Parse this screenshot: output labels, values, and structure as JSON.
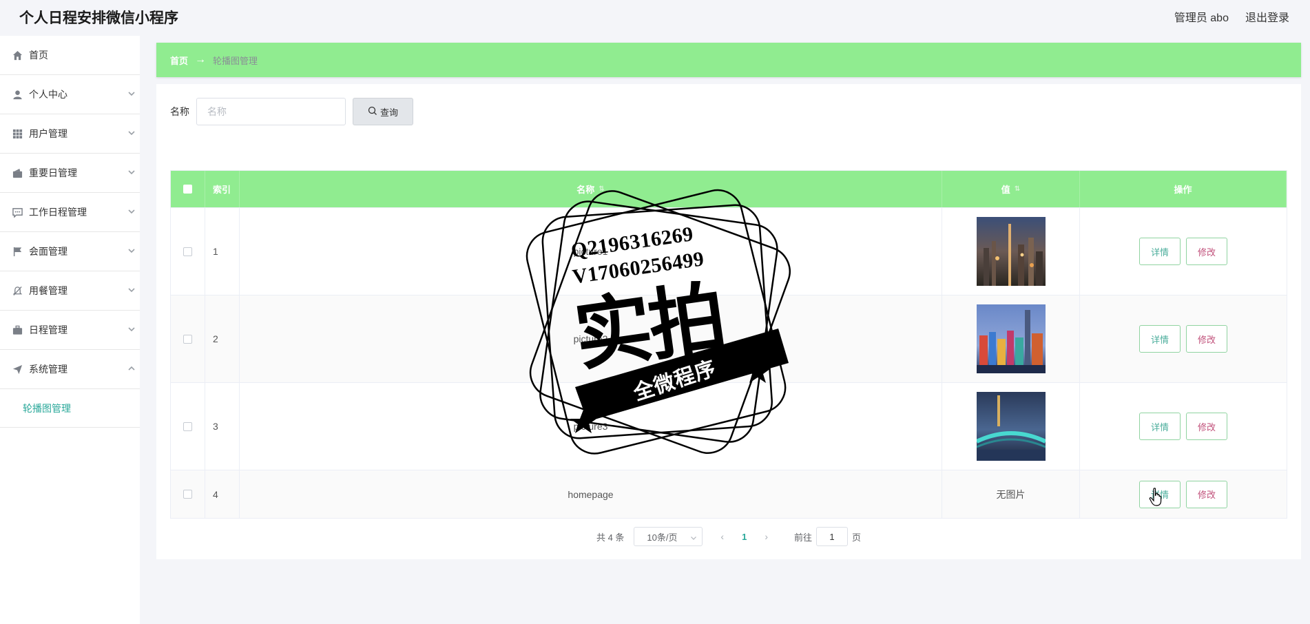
{
  "app": {
    "title": "个人日程安排微信小程序",
    "user_label": "管理员 abo",
    "logout_label": "退出登录"
  },
  "sidebar": {
    "items": [
      {
        "label": "首页",
        "icon": "home-icon",
        "has_chevron": false
      },
      {
        "label": "个人中心",
        "icon": "user-icon",
        "has_chevron": true
      },
      {
        "label": "用户管理",
        "icon": "grid-icon",
        "has_chevron": true
      },
      {
        "label": "重要日管理",
        "icon": "wallet-icon",
        "has_chevron": true
      },
      {
        "label": "工作日程管理",
        "icon": "chat-icon",
        "has_chevron": true
      },
      {
        "label": "会面管理",
        "icon": "flag-icon",
        "has_chevron": true
      },
      {
        "label": "用餐管理",
        "icon": "bell-off-icon",
        "has_chevron": true
      },
      {
        "label": "日程管理",
        "icon": "briefcase-icon",
        "has_chevron": true
      },
      {
        "label": "系统管理",
        "icon": "send-icon",
        "has_chevron": true,
        "expanded": true
      }
    ],
    "submenu": {
      "label": "轮播图管理",
      "active": true
    }
  },
  "breadcrumb": {
    "home": "首页",
    "separator": "→",
    "current": "轮播图管理"
  },
  "search": {
    "label": "名称",
    "placeholder": "名称",
    "button_label": "查询"
  },
  "table": {
    "headers": {
      "index": "索引",
      "name": "名称",
      "value": "值",
      "actions": "操作"
    },
    "rows": [
      {
        "index": "1",
        "name": "picture1",
        "value_image": "city-night-thumbnail"
      },
      {
        "index": "2",
        "name": "picture2",
        "value_image": "colorful-buildings-thumbnail"
      },
      {
        "index": "3",
        "name": "picture3",
        "value_image": "bridge-night-thumbnail"
      },
      {
        "index": "4",
        "name": "homepage",
        "value_text": "无图片"
      }
    ],
    "detail_label": "详情",
    "edit_label": "修改"
  },
  "pagination": {
    "total": "共 4 条",
    "page_size": "10条/页",
    "current_page": "1",
    "goto_label": "前往",
    "goto_value": "1",
    "page_suffix": "页"
  },
  "watermark": {
    "line1": "Q2196316269",
    "line2": "V17060256499",
    "big": "实拍",
    "banner": "全微程序"
  },
  "colors": {
    "accent_green": "#90ec90",
    "active_teal": "#2aa89a",
    "edit_pink": "#c0507a"
  }
}
